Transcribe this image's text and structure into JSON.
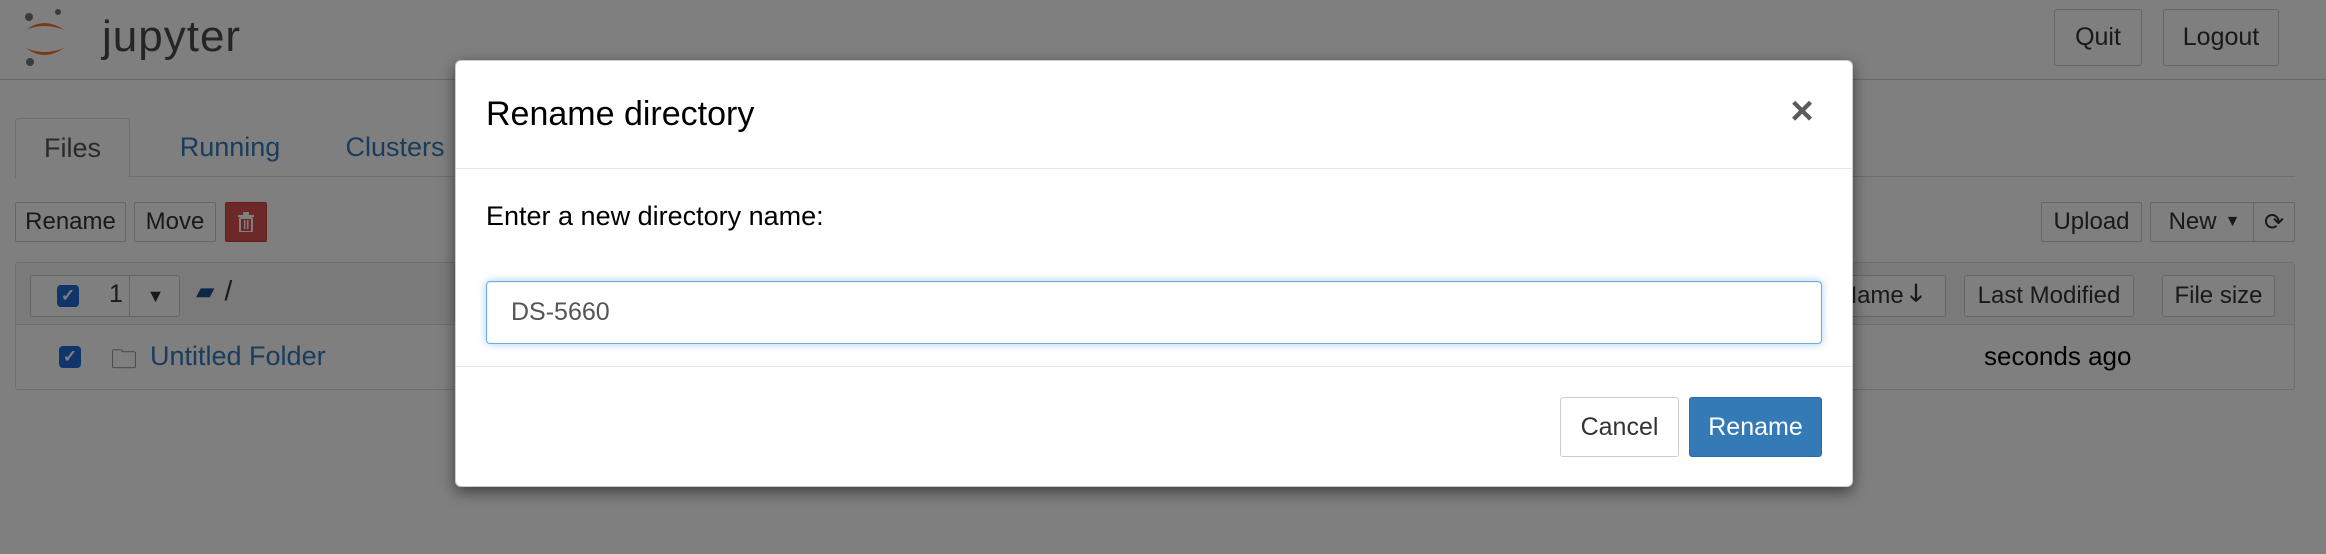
{
  "header": {
    "logo_text": "jupyter",
    "quit_label": "Quit",
    "logout_label": "Logout"
  },
  "tabs": [
    {
      "label": "Files",
      "active": true
    },
    {
      "label": "Running",
      "active": false
    },
    {
      "label": "Clusters",
      "active": false
    }
  ],
  "toolbar": {
    "rename_label": "Rename",
    "move_label": "Move",
    "delete_icon": "trash-icon",
    "upload_label": "Upload",
    "new_label": "New",
    "refresh_icon": "refresh-icon"
  },
  "file_list": {
    "selected_count": "1",
    "breadcrumb": "/",
    "columns": {
      "name": "Name",
      "last_modified": "Last Modified",
      "file_size": "File size"
    },
    "rows": [
      {
        "name": "Untitled Folder",
        "modified": "seconds ago",
        "checked": true
      }
    ]
  },
  "modal": {
    "title": "Rename directory",
    "close_symbol": "×",
    "prompt": "Enter a new directory name:",
    "input_value": "DS-5660",
    "cancel_label": "Cancel",
    "rename_label": "Rename"
  },
  "colors": {
    "primary": "#337ab7",
    "danger": "#d9534f",
    "jupyter_orange": "#f37726",
    "checkbox": "#1e6bd6"
  }
}
